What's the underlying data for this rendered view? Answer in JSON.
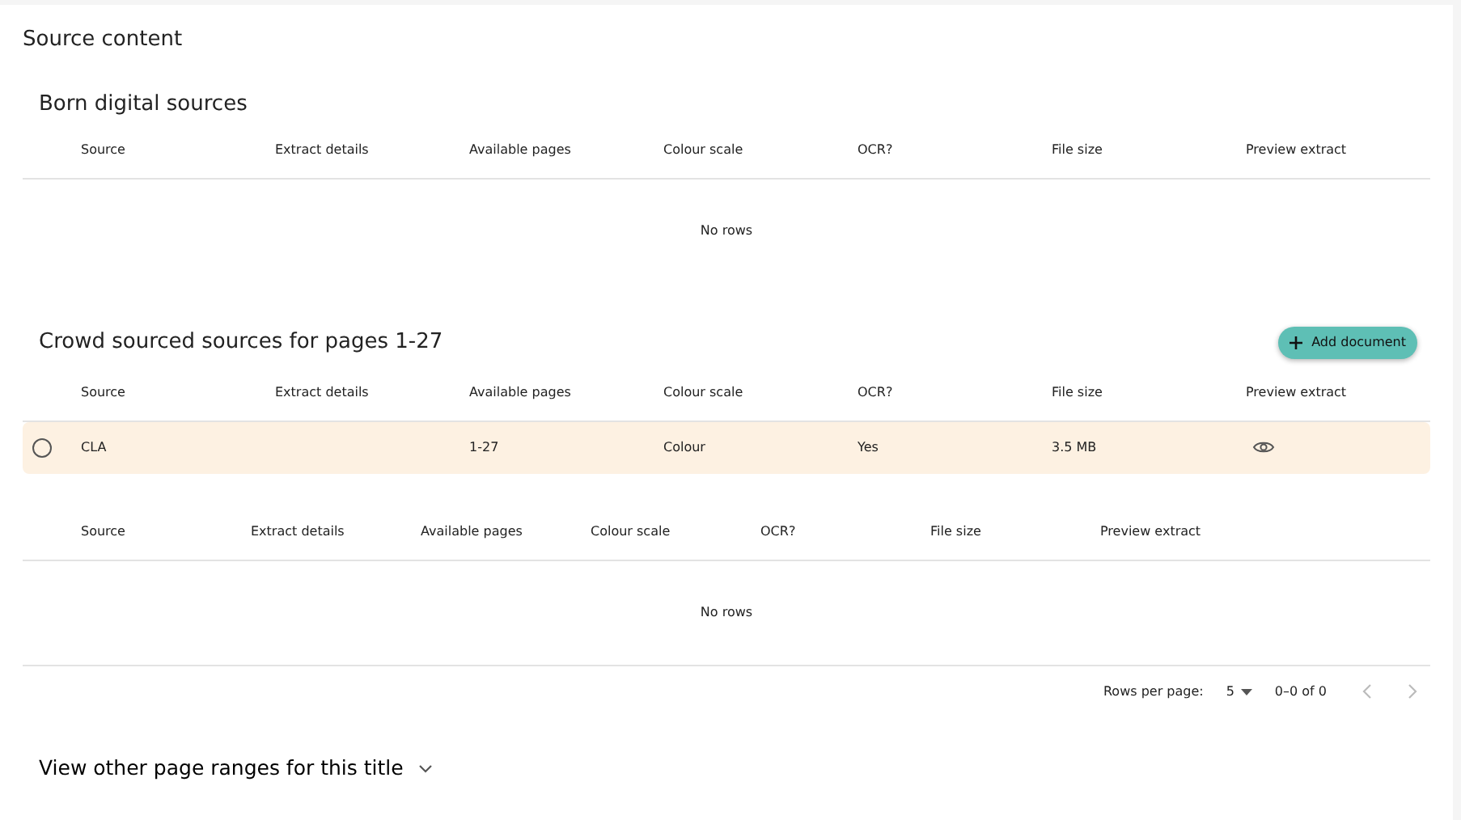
{
  "title": "Source content",
  "sections": [
    {
      "heading": "Born digital sources",
      "table": {
        "columns": [
          "Source",
          "Extract details",
          "Available pages",
          "Colour scale",
          "OCR?",
          "File size",
          "Preview extract"
        ],
        "empty_text": "No rows"
      }
    },
    {
      "heading": "Crowd sourced sources for pages 1-27",
      "action": {
        "label": "Add document"
      },
      "table": {
        "columns": [
          "Source",
          "Extract details",
          "Available pages",
          "Colour scale",
          "OCR?",
          "File size",
          "Preview extract"
        ],
        "rows": [
          {
            "selected": false,
            "highlighted": true,
            "source": "CLA",
            "available_pages": "1-27",
            "colour_scale": "Colour",
            "ocr": "Yes",
            "file_size": "3.5 MB",
            "preview": true
          }
        ]
      }
    },
    {
      "table": {
        "columns": [
          "Source",
          "Extract details",
          "Available pages",
          "Colour scale",
          "OCR?",
          "File size",
          "Preview extract"
        ],
        "empty_text": "No rows"
      },
      "pagination": {
        "label": "Rows per page:",
        "rows_per_page": "5",
        "range": "0–0 of 0",
        "prev_disabled": true,
        "next_disabled": true
      }
    }
  ],
  "expander": {
    "label": "View other page ranges for this title",
    "expanded": false
  }
}
